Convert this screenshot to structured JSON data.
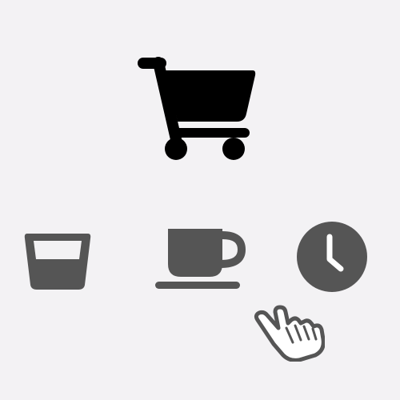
{
  "icons": [
    {
      "id": "cart",
      "name": "shopping-cart-icon",
      "color": "#000000"
    },
    {
      "id": "glass",
      "name": "glass-icon",
      "color": "#555555"
    },
    {
      "id": "cup",
      "name": "coffee-cup-icon",
      "color": "#555555"
    },
    {
      "id": "clock",
      "name": "clock-icon",
      "color": "#555555"
    },
    {
      "id": "cursor",
      "name": "hand-pointer-cursor-icon",
      "color": "#555555"
    }
  ],
  "colors": {
    "background": "#f3f2f4",
    "primary_icon": "#000000",
    "secondary_icon": "#555555",
    "cursor_outline": "#555555",
    "cursor_fill": "#ffffff"
  }
}
